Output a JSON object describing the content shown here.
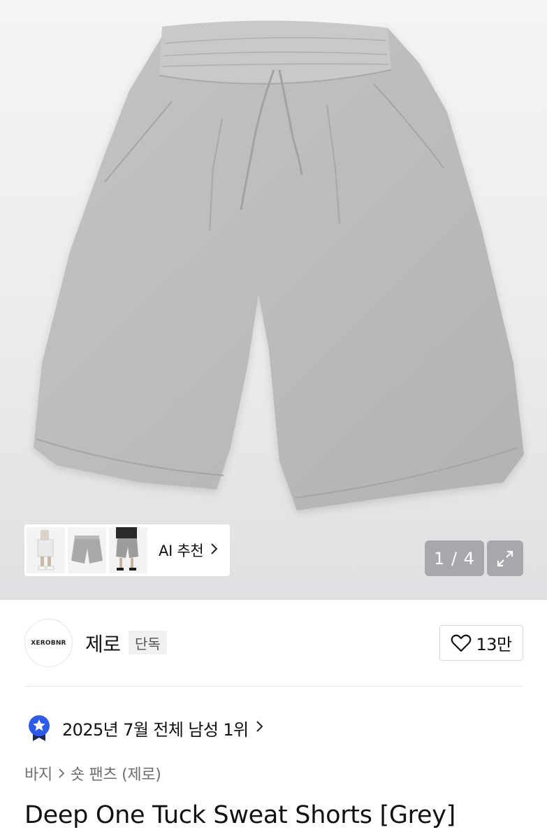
{
  "gallery": {
    "ai_recommend_label": "AI 추천",
    "current_image": 1,
    "total_images": 4,
    "counter_text": "1 / 4"
  },
  "brand": {
    "logo_text": "XEROBNR",
    "name": "제로",
    "badge": "단독",
    "like_count": "13만"
  },
  "ranking": {
    "text": "2025년 7월 전체 남성 1위"
  },
  "breadcrumb": {
    "items": [
      "바지",
      "숏 팬츠 (제로)"
    ]
  },
  "product": {
    "title": "Deep One Tuck Sweat Shorts [Grey]"
  },
  "colors": {
    "fabric_grey": "#bdbdbf",
    "badge_bg": "#f1f1f1",
    "ranking_icon": "#2f5bea"
  },
  "icons": [
    "chevron-right-icon",
    "expand-icon",
    "heart-icon",
    "ranking-medal-icon"
  ]
}
